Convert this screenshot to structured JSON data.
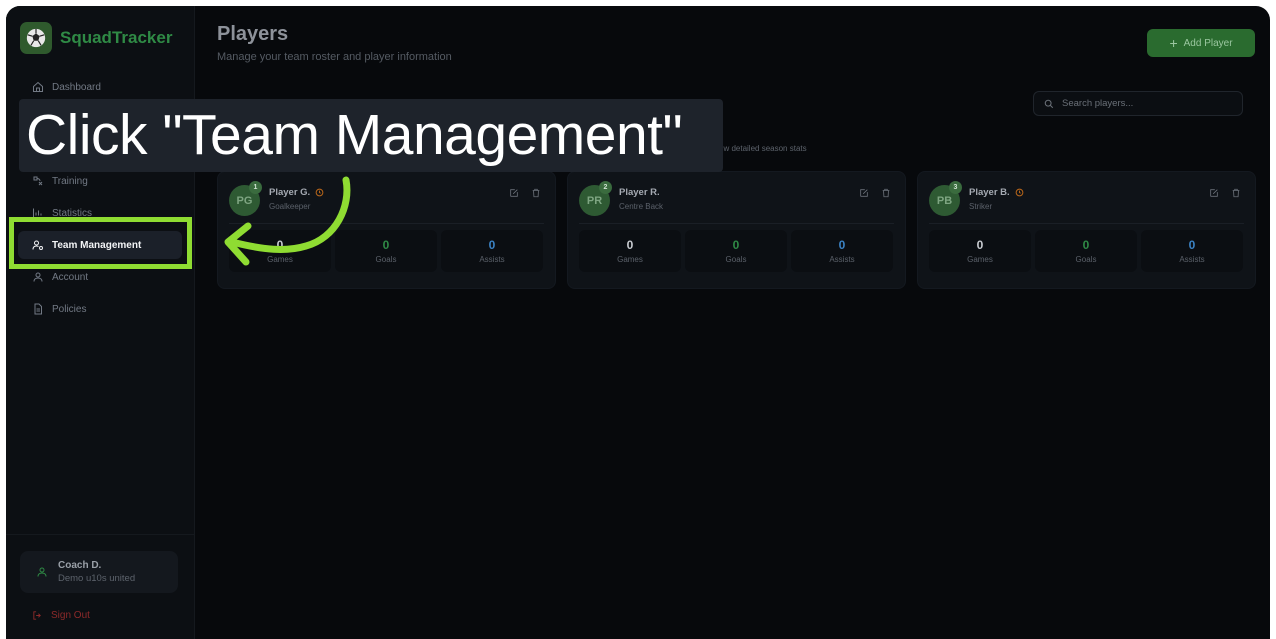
{
  "app": {
    "name": "SquadTracker",
    "brand_color": "#2f8a45"
  },
  "sidebar": {
    "items": [
      {
        "label": "Dashboard",
        "icon": "home-icon",
        "active": false
      },
      {
        "label": "Training",
        "icon": "training-icon",
        "active": false
      },
      {
        "label": "Statistics",
        "icon": "bar-chart-icon",
        "active": false
      },
      {
        "label": "Team Management",
        "icon": "user-cog-icon",
        "active": true
      },
      {
        "label": "Account",
        "icon": "user-icon",
        "active": false
      },
      {
        "label": "Policies",
        "icon": "document-icon",
        "active": false
      }
    ],
    "user": {
      "name": "Coach D.",
      "team": "Demo u10s united"
    },
    "sign_out": "Sign Out"
  },
  "header": {
    "title": "Players",
    "subtitle": "Manage your team roster and player information",
    "add_button": "Add Player"
  },
  "search": {
    "placeholder": "Search players..."
  },
  "hint_fragment": "ew detailed season stats",
  "players": [
    {
      "initials": "PG",
      "number": "1",
      "name": "Player G.",
      "position": "Goalkeeper",
      "has_status_icon": true,
      "stats": [
        {
          "value": "0",
          "label": "Games"
        },
        {
          "value": "0",
          "label": "Goals"
        },
        {
          "value": "0",
          "label": "Assists"
        }
      ]
    },
    {
      "initials": "PR",
      "number": "2",
      "name": "Player R.",
      "position": "Centre Back",
      "has_status_icon": false,
      "stats": [
        {
          "value": "0",
          "label": "Games"
        },
        {
          "value": "0",
          "label": "Goals"
        },
        {
          "value": "0",
          "label": "Assists"
        }
      ]
    },
    {
      "initials": "PB",
      "number": "3",
      "name": "Player B.",
      "position": "Striker",
      "has_status_icon": true,
      "stats": [
        {
          "value": "0",
          "label": "Games"
        },
        {
          "value": "0",
          "label": "Goals"
        },
        {
          "value": "0",
          "label": "Assists"
        }
      ]
    }
  ],
  "stat_colors": {
    "games": "#c9ccd1",
    "goals": "#2f8a45",
    "assists": "#3b82c4"
  },
  "overlay": {
    "instruction": "Click \"Team Management\"",
    "highlight_color": "#8fdc32"
  }
}
